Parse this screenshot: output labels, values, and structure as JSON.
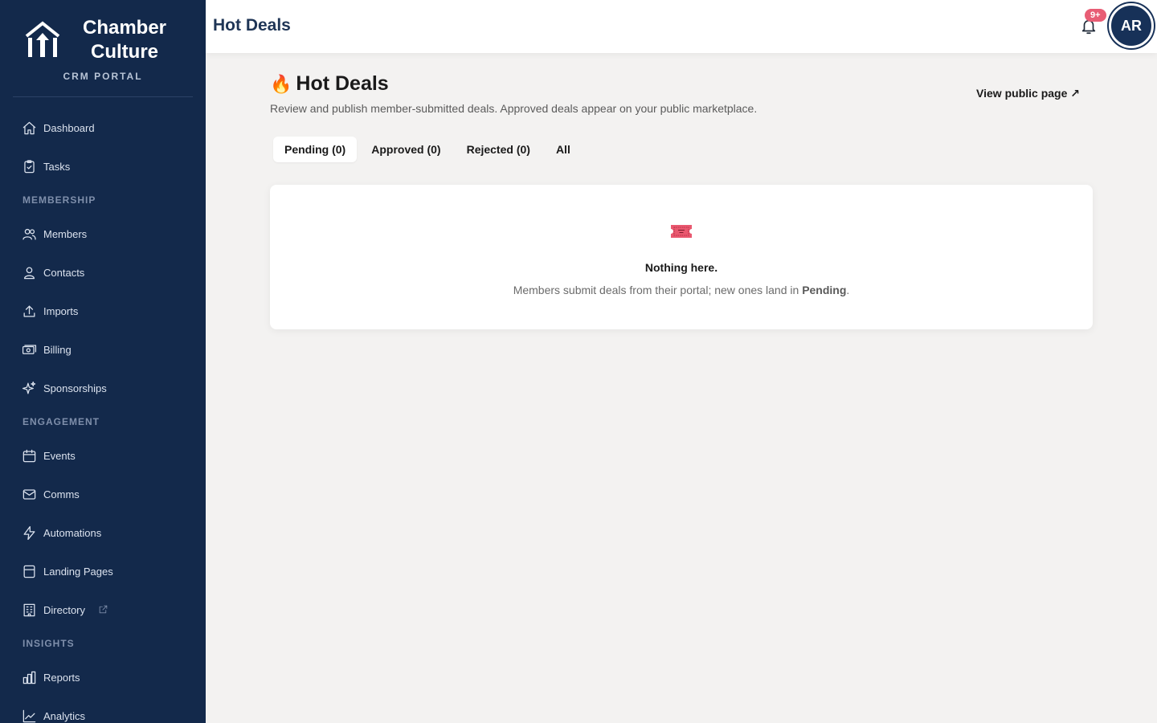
{
  "brand": {
    "name_line1": "Chamber",
    "name_line2": "Culture",
    "subtitle": "CRM PORTAL"
  },
  "sidebar": {
    "items": [
      {
        "label": "Dashboard",
        "icon": "home-icon"
      },
      {
        "label": "Tasks",
        "icon": "clipboard-check-icon"
      }
    ],
    "sections": [
      {
        "title": "MEMBERSHIP",
        "items": [
          {
            "label": "Members",
            "icon": "users-icon"
          },
          {
            "label": "Contacts",
            "icon": "user-icon"
          },
          {
            "label": "Imports",
            "icon": "upload-icon"
          },
          {
            "label": "Billing",
            "icon": "cash-icon"
          },
          {
            "label": "Sponsorships",
            "icon": "sparkles-icon"
          }
        ]
      },
      {
        "title": "ENGAGEMENT",
        "items": [
          {
            "label": "Events",
            "icon": "calendar-icon"
          },
          {
            "label": "Comms",
            "icon": "mail-icon"
          },
          {
            "label": "Automations",
            "icon": "bolt-icon"
          },
          {
            "label": "Landing Pages",
            "icon": "window-icon"
          },
          {
            "label": "Directory",
            "icon": "building-icon",
            "external": true
          }
        ]
      },
      {
        "title": "INSIGHTS",
        "items": [
          {
            "label": "Reports",
            "icon": "bar-chart-icon"
          },
          {
            "label": "Analytics",
            "icon": "line-chart-icon"
          }
        ]
      }
    ]
  },
  "topbar": {
    "title": "Hot Deals",
    "notification_count": "9+",
    "avatar_initials": "AR"
  },
  "page": {
    "title": "Hot Deals",
    "title_emoji": "🔥",
    "description": "Review and publish member-submitted deals. Approved deals appear on your public marketplace.",
    "view_public_label": "View public page ↗"
  },
  "tabs": [
    {
      "label": "Pending (0)",
      "active": true
    },
    {
      "label": "Approved (0)",
      "active": false
    },
    {
      "label": "Rejected (0)",
      "active": false
    },
    {
      "label": "All",
      "active": false
    }
  ],
  "empty_state": {
    "icon": "ticket-icon",
    "title": "Nothing here.",
    "text_before": "Members submit deals from their portal; new ones land in ",
    "text_bold": "Pending",
    "text_after": "."
  },
  "colors": {
    "sidebar_bg": "#13294b",
    "badge": "#e85d75",
    "avatar_bg": "#173158",
    "page_bg": "#f3f2f1"
  }
}
